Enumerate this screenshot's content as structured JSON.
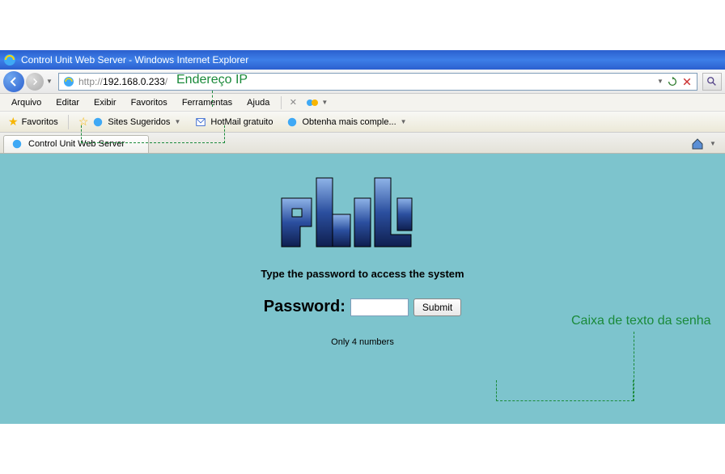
{
  "annotations": {
    "ip_label": "Endereço IP",
    "pwd_box_label": "Caixa de texto da senha"
  },
  "titlebar": {
    "title": "Control Unit Web Server - Windows Internet Explorer"
  },
  "address": {
    "scheme": "http://",
    "ip": "192.168.0.233",
    "trail": "/"
  },
  "menus": {
    "arquivo": "Arquivo",
    "editar": "Editar",
    "exibir": "Exibir",
    "favoritos": "Favoritos",
    "ferramentas": "Ferramentas",
    "ajuda": "Ajuda"
  },
  "favbar": {
    "favoritos": "Favoritos",
    "sites_sugeridos": "Sites Sugeridos",
    "hotmail": "HotMail gratuito",
    "obtenha": "Obtenha mais comple..."
  },
  "tab": {
    "title": "Control Unit Web Server"
  },
  "login": {
    "prompt": "Type the password to access the system",
    "label": "Password:",
    "submit": "Submit",
    "hint": "Only 4 numbers"
  }
}
